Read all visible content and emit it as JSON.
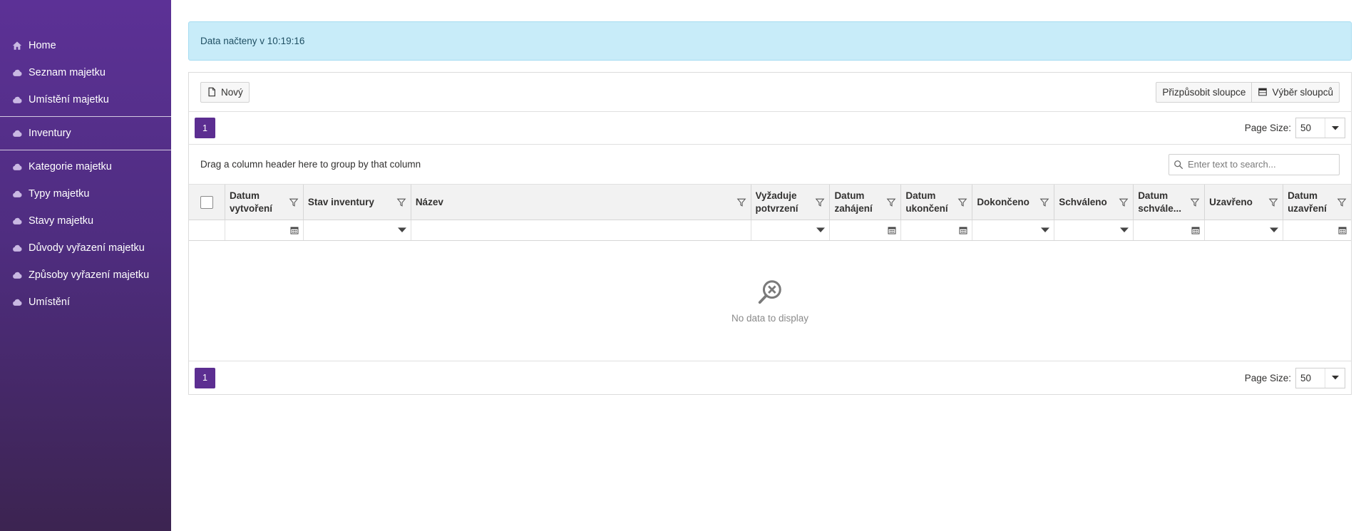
{
  "sidebar": {
    "items": [
      {
        "label": "Home",
        "icon": "home-icon"
      },
      {
        "label": "Seznam majetku",
        "icon": "cloud-icon"
      },
      {
        "label": "Umístění majetku",
        "icon": "cloud-icon"
      },
      {
        "label": "Inventury",
        "icon": "cloud-icon"
      },
      {
        "label": "Kategorie majetku",
        "icon": "cloud-icon"
      },
      {
        "label": "Typy majetku",
        "icon": "cloud-icon"
      },
      {
        "label": "Stavy majetku",
        "icon": "cloud-icon"
      },
      {
        "label": "Důvody vyřazení majetku",
        "icon": "cloud-icon"
      },
      {
        "label": "Způsoby vyřazení majetku",
        "icon": "cloud-icon"
      },
      {
        "label": "Umístění",
        "icon": "cloud-icon"
      }
    ]
  },
  "alert": {
    "text": "Data načteny v 10:19:16"
  },
  "toolbar": {
    "new_label": "Nový",
    "customize_label": "Přizpůsobit sloupce",
    "chooser_label": "Výběr sloupců"
  },
  "pager": {
    "current_page": "1",
    "page_size_label": "Page Size:",
    "page_size_value": "50"
  },
  "groupbar": {
    "text": "Drag a column header here to group by that column"
  },
  "search": {
    "placeholder": "Enter text to search..."
  },
  "columns": [
    {
      "label": "Datum vytvoření",
      "filter": "date"
    },
    {
      "label": "Stav inventury",
      "filter": "dropdown"
    },
    {
      "label": "Název",
      "filter": "none"
    },
    {
      "label": "Vyžaduje potvrzení",
      "filter": "dropdown"
    },
    {
      "label": "Datum zahájení",
      "filter": "date"
    },
    {
      "label": "Datum ukončení",
      "filter": "date"
    },
    {
      "label": "Dokončeno",
      "filter": "dropdown"
    },
    {
      "label": "Schváleno",
      "filter": "dropdown"
    },
    {
      "label": "Datum schvále...",
      "filter": "date"
    },
    {
      "label": "Uzavřeno",
      "filter": "dropdown"
    },
    {
      "label": "Datum uzavření",
      "filter": "date"
    }
  ],
  "empty": {
    "message": "No data to display"
  },
  "colors": {
    "accent": "#5c2e91",
    "alert_bg": "#c8ecf9",
    "sidebar_top": "#5c3196",
    "sidebar_bottom": "#3c2451"
  }
}
